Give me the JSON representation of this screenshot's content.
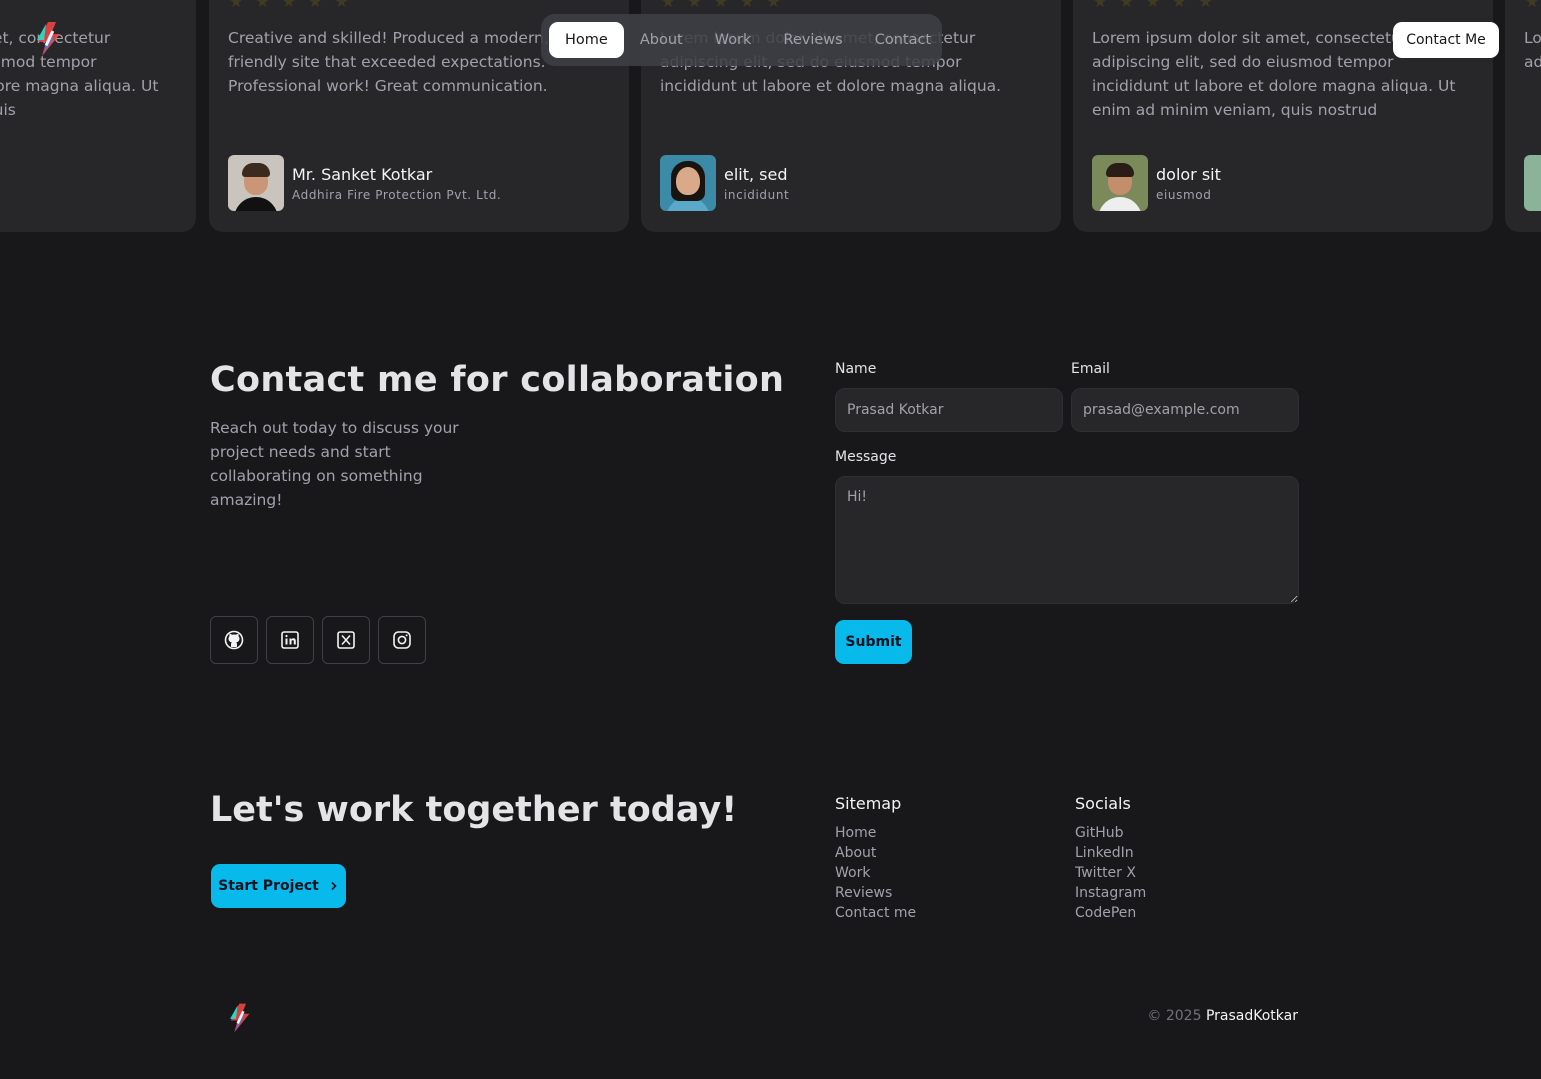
{
  "colors": {
    "background": "#18181b",
    "card": "#27272a",
    "accent": "#08b9ec",
    "star": "#3f3a22"
  },
  "nav": {
    "items": [
      "Home",
      "About",
      "Work",
      "Reviews",
      "Contact"
    ],
    "active": "Home",
    "cta_label": "Contact Me"
  },
  "reviews": [
    {
      "text": "Lorem ipsum dolor sit amet, consectetur adipiscing elit, sed do eiusmod tempor incididunt ut labore et dolore magna aliqua. Ut enim ad minim veniam, quis",
      "author": "",
      "company": "",
      "rating": 5
    },
    {
      "text": "Creative and skilled! Produced a modern, user-friendly site that exceeded expectations. Professional work! Great communication.",
      "author": "Mr. Sanket Kotkar",
      "company": "Addhira Fire Protection Pvt. Ltd.",
      "rating": 5
    },
    {
      "text": "Lorem ipsum dolor sit amet, consectetur adipiscing elit, sed do eiusmod tempor incididunt ut labore et dolore magna aliqua.",
      "author": "elit, sed",
      "company": "incididunt",
      "rating": 5
    },
    {
      "text": "Lorem ipsum dolor sit amet, consectetur adipiscing elit, sed do eiusmod tempor incididunt ut labore et dolore magna aliqua. Ut enim ad minim veniam, quis nostrud",
      "author": "dolor sit",
      "company": "eiusmod",
      "rating": 5
    },
    {
      "text": "Lorem ipsum dolor sit amet, consectetur adipiscing elit, sed do",
      "author": "",
      "company": "",
      "rating": 5
    }
  ],
  "contact": {
    "title": "Contact me for collaboration",
    "subtitle": "Reach out today to discuss your project needs and start collaborating on something amazing!",
    "name_label": "Name",
    "name_placeholder": "Prasad Kotkar",
    "email_label": "Email",
    "email_placeholder": "prasad@example.com",
    "message_label": "Message",
    "message_placeholder": "Hi!",
    "submit_label": "Submit",
    "socials": [
      "github-icon",
      "linkedin-icon",
      "x-icon",
      "instagram-icon"
    ]
  },
  "footer": {
    "cta_title": "Let's work together today!",
    "start_label": "Start Project",
    "sitemap_title": "Sitemap",
    "sitemap": [
      "Home",
      "About",
      "Work",
      "Reviews",
      "Contact me"
    ],
    "socials_title": "Socials",
    "socials": [
      "GitHub",
      "LinkedIn",
      "Twitter X",
      "Instagram",
      "CodePen"
    ],
    "copyright_prefix": "© 2025",
    "copyright_name": "PrasadKotkar"
  }
}
